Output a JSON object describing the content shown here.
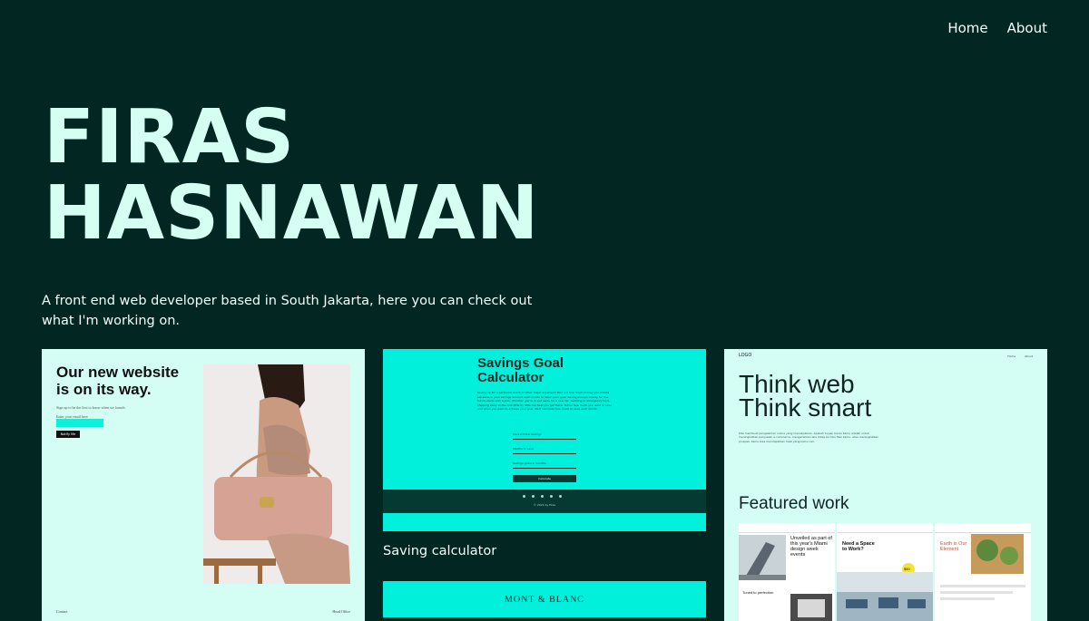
{
  "nav": {
    "items": [
      {
        "label": "Home"
      },
      {
        "label": "About"
      }
    ]
  },
  "hero": {
    "name_line1": "FIRAS",
    "name_line2": "HASNAWAN"
  },
  "intro": {
    "text": "A front end web developer based in South Jakarta, here you can check out what I'm working on."
  },
  "projects": [
    {
      "heading": "Our new website is on its way.",
      "signup_text": "Sign up to be the first to know when we launch.",
      "email_placeholder": "Enter your email here",
      "button": "Notify Me",
      "footer_left": "Contact",
      "footer_right": "Head Office"
    },
    {
      "heading": "Savings Goal Calculator",
      "paragraph": "Saving up for a particular event or other major expenses? Find out how much money you should set aside in your savings account each month to reach your goal. Saving enough money for the future starts with a plan. Whether you're to put aside for a new car, wedding or emergency fund, chipping away at the cost little by little can help you get there. Tell us how much you want to save and when you want to achieve your goal. We'll calculate how much to save each month.",
      "field1": "Desired total savings",
      "field2": "Months to save",
      "field3": "Savings goals in months",
      "button": "Calculate",
      "copyright": "© 2021 by Firas",
      "caption": "Saving calculator"
    },
    {
      "logo": "LOGO",
      "nav": [
        "Home",
        "About"
      ],
      "heading": "Think web Think smart",
      "paragraph": "Kita membuat pengalaman online yang menakjubkan. Apakah tujuan bisnis kamu adalah untuk meningkatkan penjualan e-commerce, mengarahkan lalu lintas ke toko fisik kamu, atau meningkatkan prospek, kamu bisa mendapatkan hasil yang kamu cari.",
      "featured": "Featured work",
      "mini1_title": "Unveiled as part of this year's Miami design week events",
      "mini1_sub": "Tuned to perfection",
      "mini2_title": "Need a Space to Work?",
      "mini3_title": "Earth is Our Element",
      "mini_price": "$50"
    },
    {
      "brand": "MONT & BLANC"
    }
  ],
  "colors": {
    "background": "#022722",
    "accent": "#00f0dc",
    "card_light": "#d4fdf3"
  }
}
